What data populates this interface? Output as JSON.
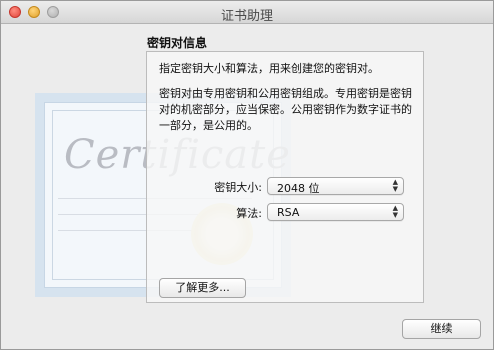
{
  "window": {
    "title": "证书助理"
  },
  "panel": {
    "heading": "密钥对信息",
    "intro": "指定密钥大小和算法，用来创建您的密钥对。",
    "description": "密钥对由专用密钥和公用密钥组成。专用密钥是密钥对的机密部分，应当保密。公用密钥作为数字证书的一部分，是公用的。",
    "key_size_label": "密钥大小:",
    "key_size_value": "2048 位",
    "algorithm_label": "算法:",
    "algorithm_value": "RSA",
    "learn_more_button": "了解更多..."
  },
  "footer": {
    "continue_button": "继续"
  },
  "background_art": {
    "certificate_word": "Certificate"
  }
}
